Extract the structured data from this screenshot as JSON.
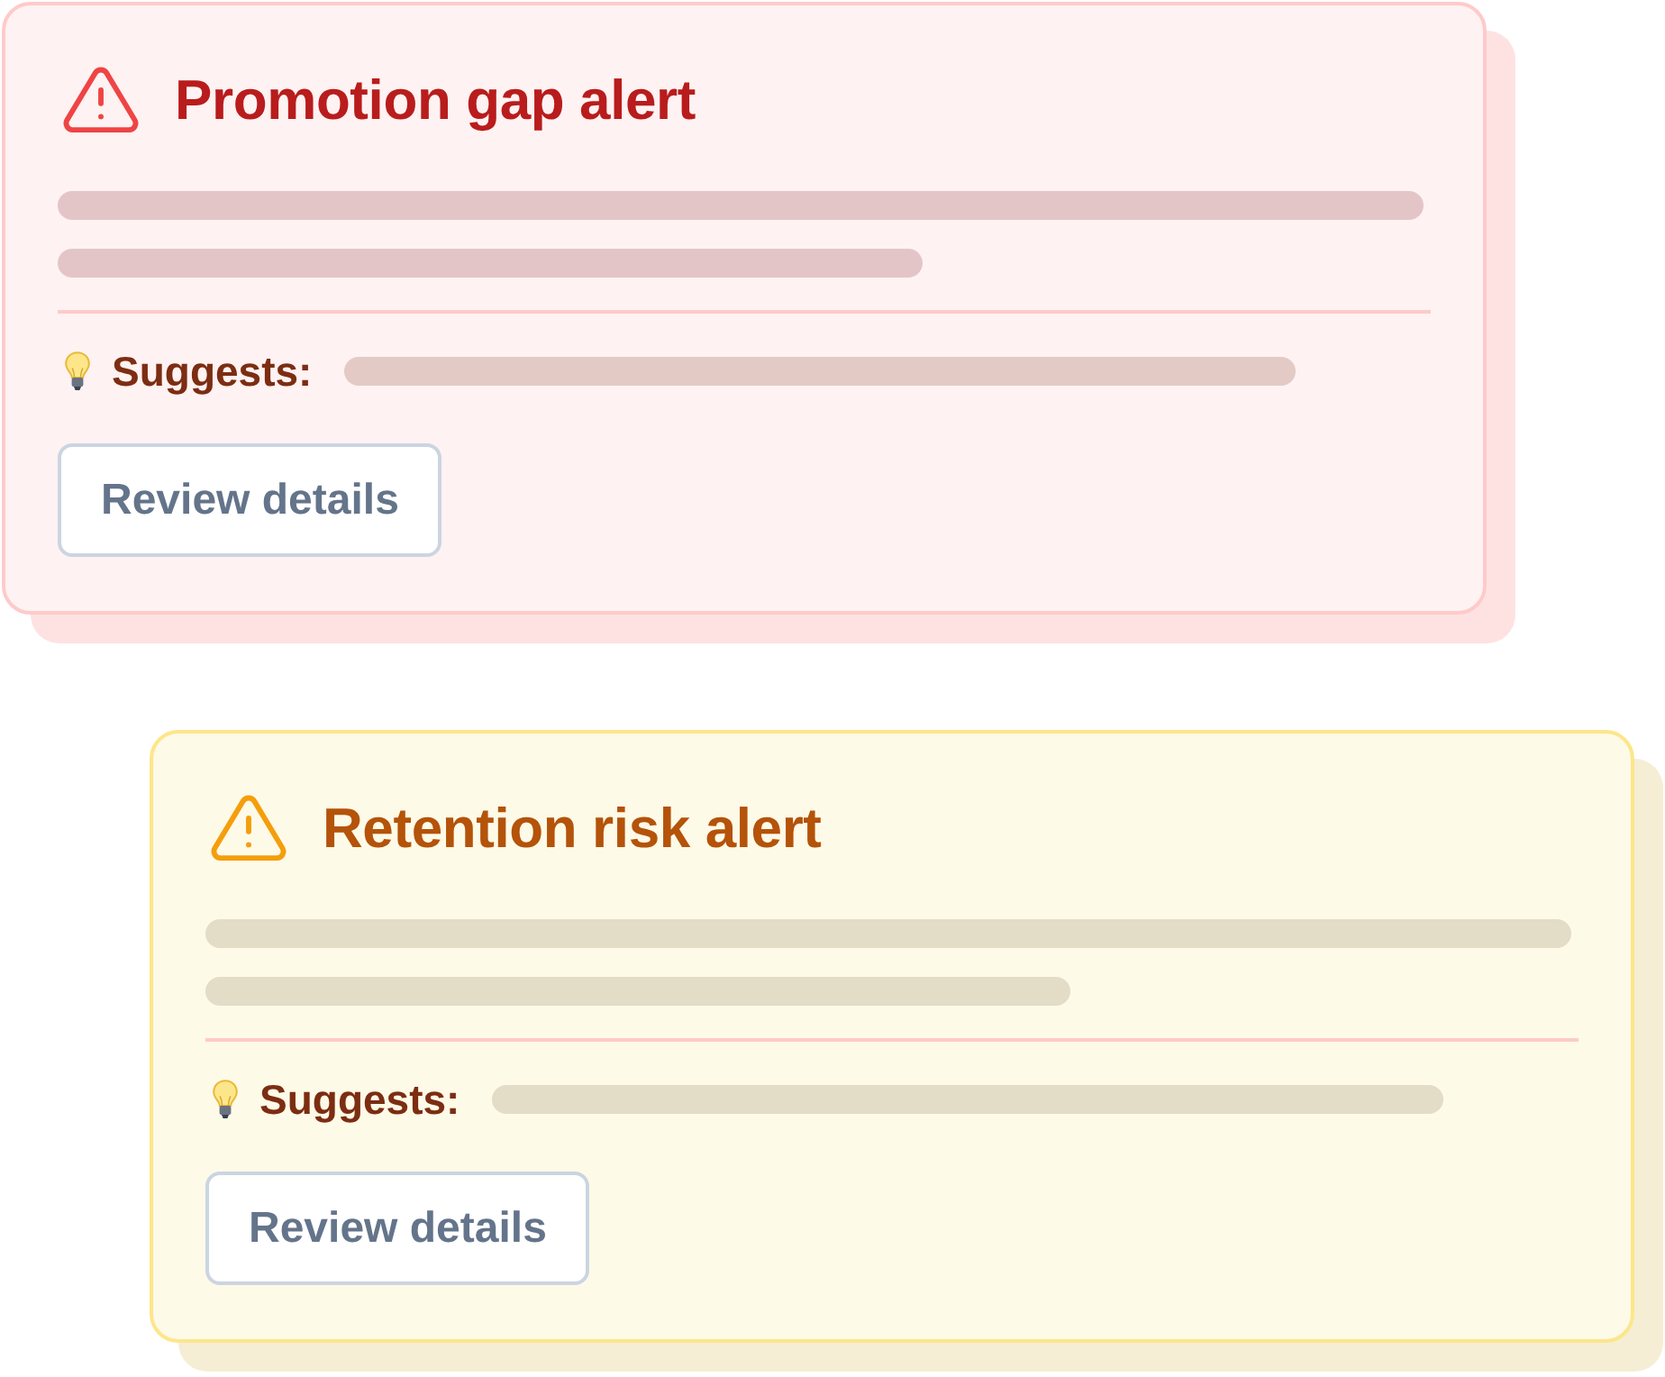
{
  "alerts": [
    {
      "kind": "error",
      "title": "Promotion gap alert",
      "suggests_label": "Suggests:",
      "button": "Review details"
    },
    {
      "kind": "warning",
      "title": "Retention risk alert",
      "suggests_label": "Suggests:",
      "button": "Review details"
    }
  ]
}
